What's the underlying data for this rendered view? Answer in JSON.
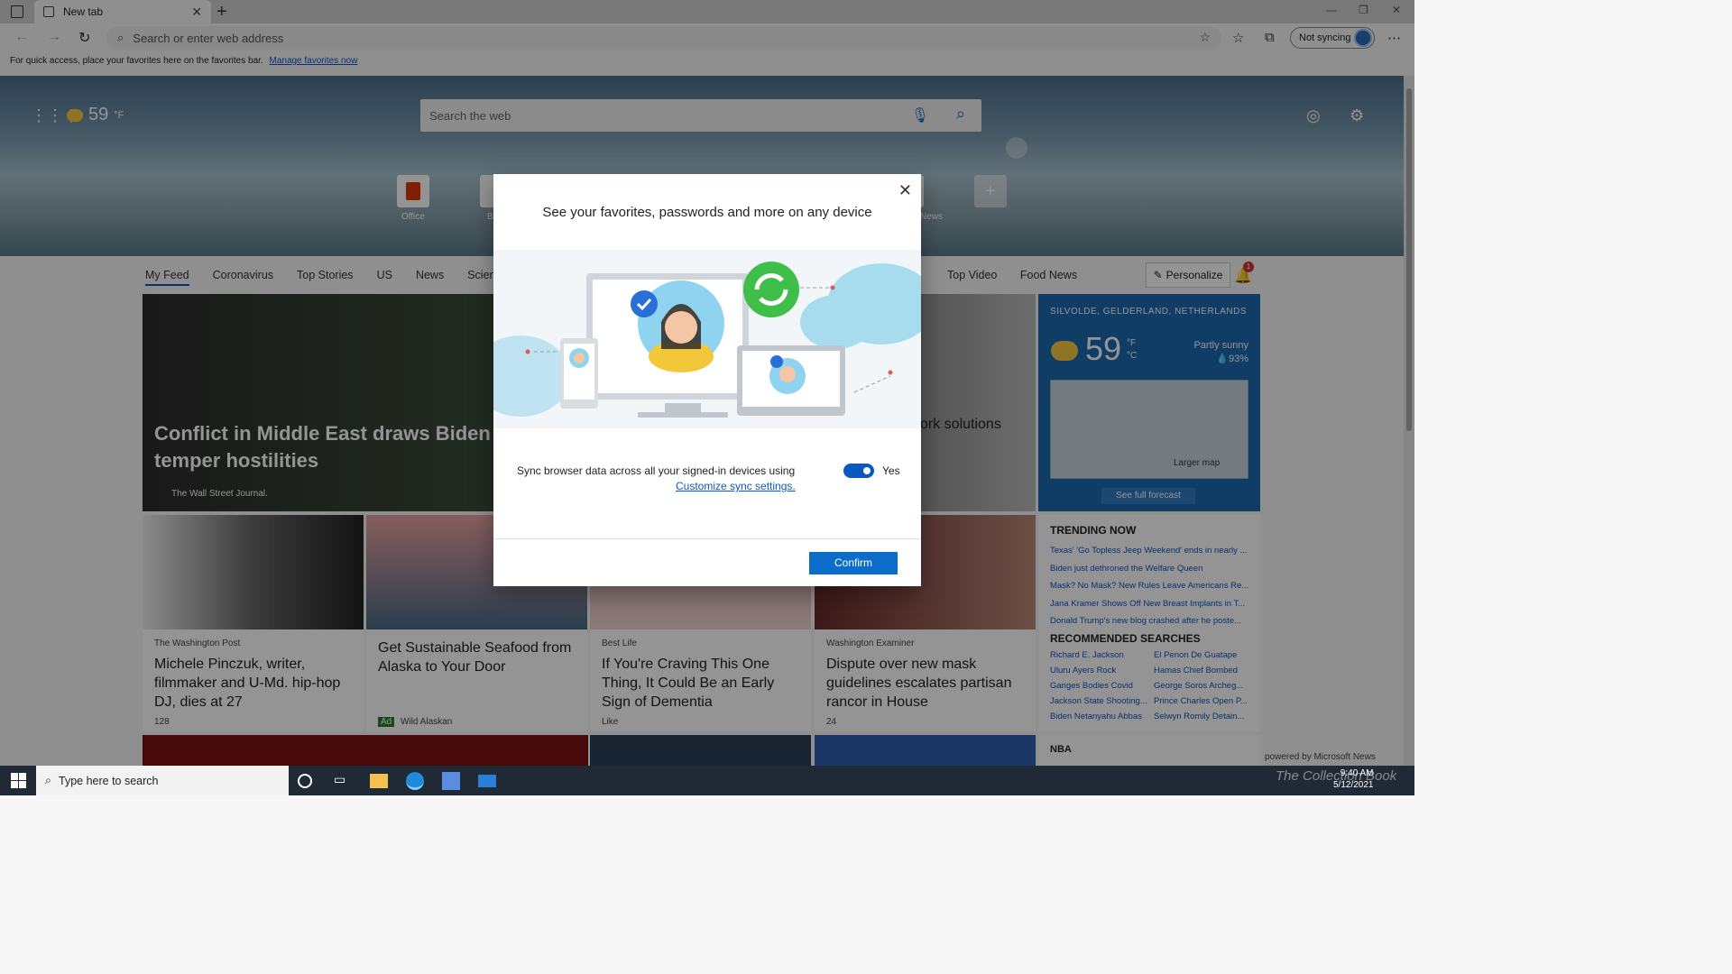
{
  "browser": {
    "tab_title": "New tab",
    "address_placeholder": "Search or enter web address",
    "sync_button": "Not syncing",
    "favorites_hint": "For quick access, place your favorites here on the favorites bar.",
    "favorites_link": "Manage favorites now"
  },
  "newtab": {
    "weather_temp": "59",
    "weather_unit": "°F",
    "search_placeholder": "Search the web",
    "quick_links": [
      {
        "label": "Office"
      },
      {
        "label": "B"
      },
      {
        "label": "News"
      }
    ]
  },
  "feed": {
    "tabs": [
      "My Feed",
      "Coronavirus",
      "Top Stories",
      "US",
      "News",
      "Science"
    ],
    "tabs_right": [
      "Top Video",
      "Food News"
    ],
    "personalize": "Personalize",
    "notification_count": "1",
    "hero": {
      "headline": "Conflict in Middle East draws Biden c temper hostilities",
      "source": "The Wall Street Journal.",
      "right_headline": "ork solutions"
    },
    "weather": {
      "location": "SILVOLDE, GELDERLAND, NETHERLANDS",
      "temp": "59",
      "unit_f": "°F",
      "unit_c": "°C",
      "condition": "Partly sunny",
      "humidity": "💧93%",
      "larger_map": "Larger map",
      "forecast": "See full forecast"
    },
    "cards": [
      {
        "source": "The Washington Post",
        "title": "Michele Pinczuk, writer, filmmaker and U-Md. hip-hop DJ, dies at 27",
        "footer": "128"
      },
      {
        "source": "",
        "title": "Get Sustainable Seafood from Alaska to Your Door",
        "footer": "Wild Alaskan",
        "ad": "Ad"
      },
      {
        "source": "Best Life",
        "title": "If You're Craving This One Thing, It Could Be an Early Sign of Dementia",
        "footer": "Like"
      },
      {
        "source": "Washington Examiner",
        "title": "Dispute over new mask guidelines escalates partisan rancor in House",
        "footer": "24"
      }
    ],
    "trending_title": "TRENDING NOW",
    "trending": [
      "Texas' 'Go Topless Jeep Weekend' ends in nearly ...",
      "Biden just dethroned the Welfare Queen",
      "Mask? No Mask? New Rules Leave Americans Re...",
      "Jana Kramer Shows Off New Breast Implants in T...",
      "Donald Trump's new blog crashed after he poste..."
    ],
    "recommended_title": "RECOMMENDED SEARCHES",
    "recommended": [
      "Richard E. Jackson",
      "El Penon De Guatape",
      "Uluru Ayers Rock",
      "Hamas Chief Bombed",
      "Ganges Bodies Covid",
      "George Soros Archeg...",
      "Jackson State Shooting...",
      "Prince Charles Open P...",
      "Biden Netanyahu Abbas",
      "Selwyn Romily Detain..."
    ],
    "nba": "NBA",
    "powered": "powered by Microsoft News"
  },
  "dialog": {
    "title": "See your favorites, passwords and more on any device",
    "sync_text": "Sync browser data across all your signed-in devices using",
    "customize_link": "Customize sync settings.",
    "toggle_label": "Yes",
    "toggle_on": true,
    "confirm": "Confirm"
  },
  "taskbar": {
    "search_placeholder": "Type here to search",
    "time": "9:40 AM",
    "date": "5/12/2021",
    "watermark": "The Collection Book"
  }
}
